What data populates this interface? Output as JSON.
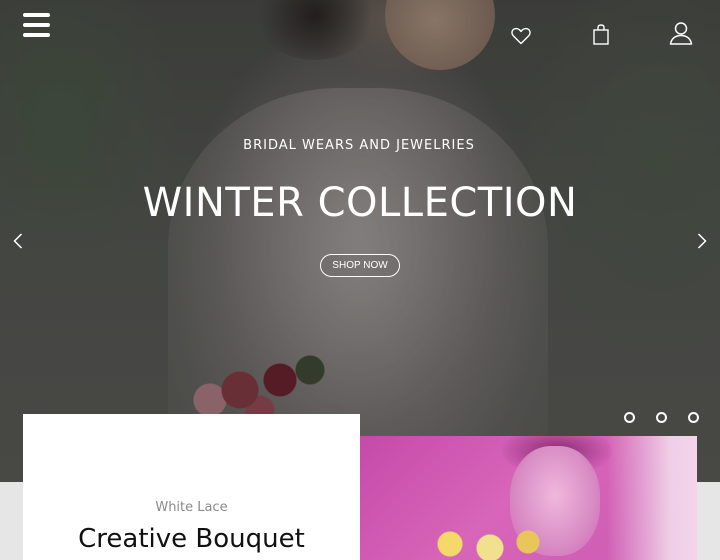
{
  "header": {
    "menu_icon": "menu-icon",
    "wishlist_icon": "heart-icon",
    "cart_icon": "shopping-bag-icon",
    "account_icon": "user-icon"
  },
  "hero": {
    "kicker": "BRIDAL WEARS AND JEWELRIES",
    "headline": "WINTER COLLECTION",
    "cta_label": "SHOP NOW",
    "prev_icon": "chevron-left-icon",
    "next_icon": "chevron-right-icon",
    "slide_count": 3
  },
  "featured": {
    "subtitle": "White Lace",
    "title": "Creative Bouquet"
  },
  "colors": {
    "overlay_text": "#ffffff",
    "accent_pink": "#cc5cb2"
  }
}
